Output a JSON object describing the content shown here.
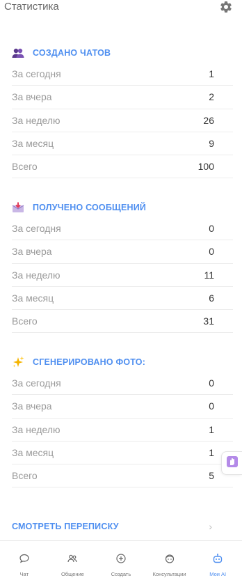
{
  "header": {
    "title": "Статистика",
    "settings_icon": "gear-icon"
  },
  "sections": [
    {
      "title": "СОЗДАНО ЧАТОВ",
      "icon": "people-icon",
      "rows": [
        {
          "label": "За сегодня",
          "value": "1"
        },
        {
          "label": "За вчера",
          "value": "2"
        },
        {
          "label": "За неделю",
          "value": "26"
        },
        {
          "label": "За месяц",
          "value": "9"
        },
        {
          "label": "Всего",
          "value": "100"
        }
      ]
    },
    {
      "title": "ПОЛУЧЕНО СООБЩЕНИЙ",
      "icon": "inbox-icon",
      "rows": [
        {
          "label": "За сегодня",
          "value": "0"
        },
        {
          "label": "За вчера",
          "value": "0"
        },
        {
          "label": "За неделю",
          "value": "11"
        },
        {
          "label": "За месяц",
          "value": "6"
        },
        {
          "label": "Всего",
          "value": "31"
        }
      ]
    },
    {
      "title": "СГЕНЕРИРОВАНО ФОТО:",
      "icon": "sparkles-icon",
      "rows": [
        {
          "label": "За сегодня",
          "value": "0"
        },
        {
          "label": "За вчера",
          "value": "0"
        },
        {
          "label": "За неделю",
          "value": "1"
        },
        {
          "label": "За месяц",
          "value": "1"
        },
        {
          "label": "Всего",
          "value": "5"
        }
      ]
    }
  ],
  "view_chats": {
    "label": "СМОТРЕТЬ ПЕРЕПИСКУ",
    "chevron": "›"
  },
  "nav": [
    {
      "label": "Чат",
      "icon": "chat-bubble-icon"
    },
    {
      "label": "Общение",
      "icon": "users-icon"
    },
    {
      "label": "Создать",
      "icon": "plus-circle-icon"
    },
    {
      "label": "Консультации",
      "icon": "face-icon"
    },
    {
      "label": "Мои AI",
      "icon": "robot-icon",
      "active": true
    }
  ],
  "colors": {
    "accent": "#4f8ff0",
    "muted": "#9a9a9a",
    "divider": "#ececec"
  }
}
